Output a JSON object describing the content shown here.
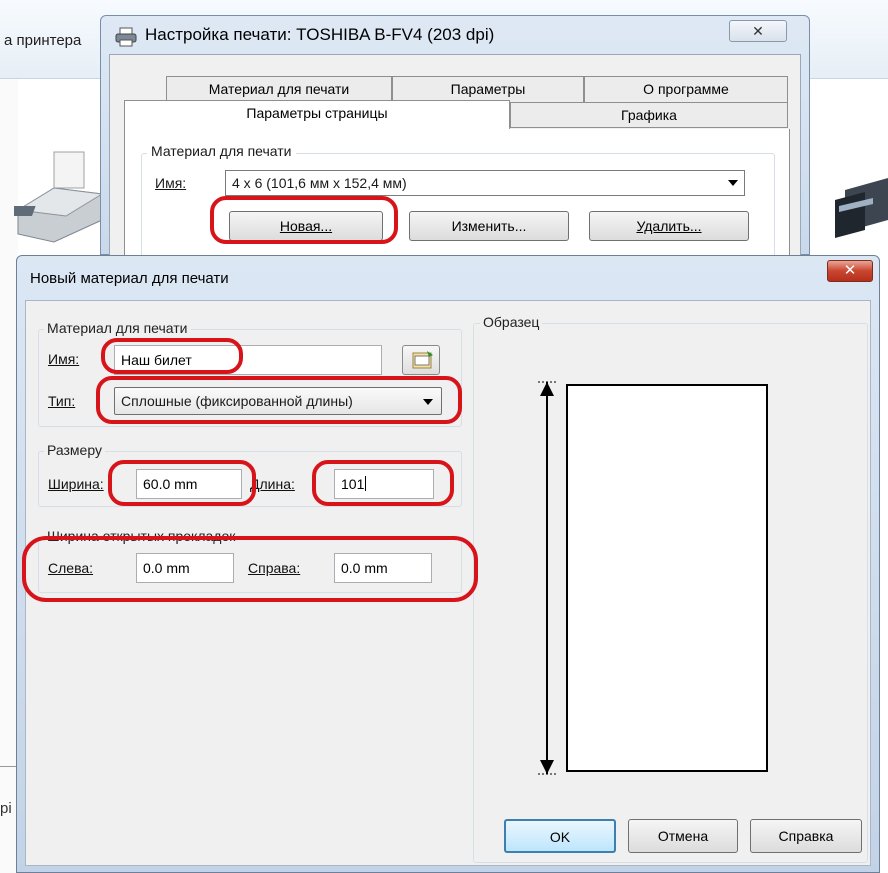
{
  "background": {
    "window_title_fragment": "а принтера",
    "left_fragment": "pi"
  },
  "print_dialog": {
    "title": "Настройка печати: TOSHIBA B-FV4 (203 dpi)",
    "close_symbol": "✕",
    "tabs_back": [
      "Материал для печати",
      "Параметры",
      "О программе"
    ],
    "tabs_front": [
      "Параметры страницы",
      "Графика"
    ],
    "active_tab": "Параметры страницы",
    "media_group": "Материал для печати",
    "name_label": "Имя:",
    "name_value": "4 x 6 (101,6 мм x 152,4 мм)",
    "buttons": {
      "new": "Новая...",
      "edit": "Изменить...",
      "delete": "Удалить..."
    }
  },
  "new_media_dialog": {
    "title": "Новый материал для печати",
    "close_symbol": "✕",
    "media_group": "Материал для печати",
    "name_label": "Имя:",
    "name_value": "Наш билет",
    "type_label": "Тип:",
    "type_value": "Сплошные (фиксированной длины)",
    "size_group": "Размеру",
    "width_label": "Ширина:",
    "width_value": "60.0 mm",
    "length_label": "Длина:",
    "length_value": "101",
    "liner_group": "Ширина открытых прокладок",
    "left_label": "Слева:",
    "left_value": "0.0 mm",
    "right_label": "Справа:",
    "right_value": "0.0 mm",
    "preview_label": "Образец",
    "buttons": {
      "ok": "OK",
      "cancel": "Отмена",
      "help": "Справка"
    }
  },
  "colors": {
    "highlight_ring": "#d7141a",
    "close_button": "#c9452f"
  }
}
